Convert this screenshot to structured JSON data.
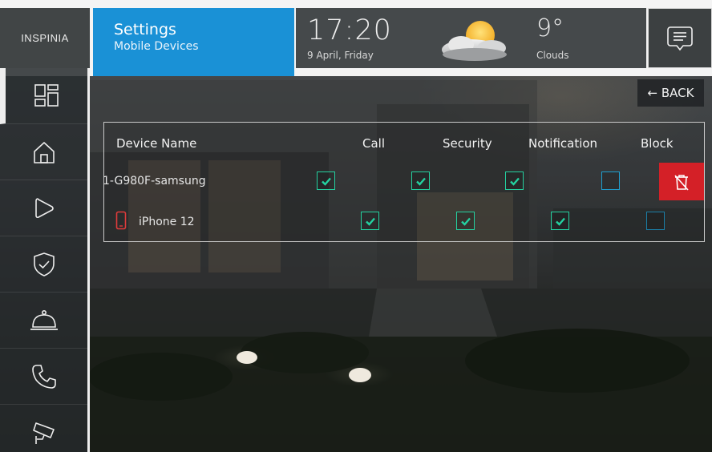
{
  "header": {
    "logo": "INSPINIA",
    "title": "Settings",
    "subtitle": "Mobile Devices",
    "time": "17:20",
    "date": "9 April, Friday",
    "temperature": "9°",
    "condition": "Clouds",
    "weather_icon": "sun-behind-cloud-icon",
    "message_icon": "message-icon"
  },
  "sidebar": {
    "items": [
      {
        "name": "dashboard",
        "icon": "dashboard-grid-icon",
        "active": true
      },
      {
        "name": "home",
        "icon": "home-icon"
      },
      {
        "name": "play",
        "icon": "play-icon"
      },
      {
        "name": "security",
        "icon": "shield-check-icon"
      },
      {
        "name": "services",
        "icon": "service-bell-icon"
      },
      {
        "name": "phone",
        "icon": "phone-icon"
      },
      {
        "name": "camera",
        "icon": "security-camera-icon"
      }
    ]
  },
  "back_button": {
    "label": "← BACK"
  },
  "table": {
    "headers": {
      "device_name": "Device Name",
      "call": "Call",
      "security": "Security",
      "notification": "Notification",
      "block": "Block"
    },
    "rows": [
      {
        "device": "1-G980F-samsung",
        "call": true,
        "security": true,
        "notification": true,
        "block": false,
        "selected": true
      },
      {
        "device": "iPhone 12",
        "call": true,
        "security": true,
        "notification": true,
        "block": false,
        "icon": "mobile-phone-icon"
      }
    ],
    "delete_icon": "delete-icon"
  },
  "colors": {
    "accent_blue": "#1a91d6",
    "checked": "#24d1a0",
    "unchecked": "#1f9ecf",
    "danger": "#d42027",
    "phone_icon": "#e03b3b"
  }
}
